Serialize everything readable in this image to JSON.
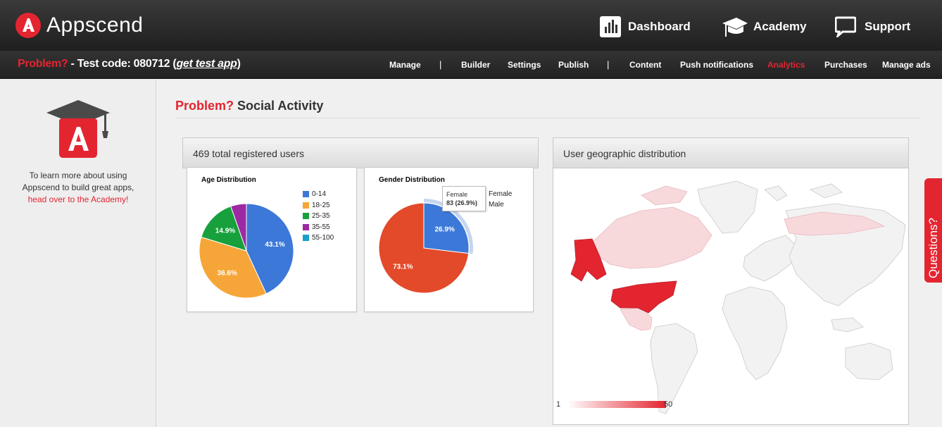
{
  "header": {
    "brand": "Appscend",
    "nav": [
      {
        "label": "Dashboard",
        "icon": "bar-chart-icon"
      },
      {
        "label": "Academy",
        "icon": "graduation-cap-icon"
      },
      {
        "label": "Support",
        "icon": "speech-bubble-icon"
      }
    ]
  },
  "subheader": {
    "app_name": "Problem?",
    "test_code_text": " - Test code: 080712 (",
    "get_test_app": "get test app",
    "close_paren": ")",
    "nav": [
      "Manage",
      "Builder",
      "Settings",
      "Publish",
      "Content",
      "Push notifications",
      "Analytics",
      "Purchases",
      "Manage ads"
    ],
    "separator": "|",
    "active": "Analytics"
  },
  "sidebar": {
    "text_line1": "To learn more about using",
    "text_line2": "Appscend to build great apps,",
    "link_text": "head over to the Academy!"
  },
  "page": {
    "title_red": "Problem?",
    "title_rest": " Social Activity"
  },
  "users_panel": {
    "header": "469 total registered users"
  },
  "geo_panel": {
    "header": "User geographic distribution",
    "scale_min": "1",
    "scale_max": "50"
  },
  "questions_tab": "Questions?",
  "colors": {
    "accent": "#e32530",
    "blue": "#3c78d8",
    "orange": "#f6a638",
    "green": "#17a03c",
    "purple": "#9d2aa3",
    "teal": "#1aa0c8",
    "male_red": "#e34a2a"
  },
  "chart_data": [
    {
      "type": "pie",
      "title": "Age Distribution",
      "categories": [
        "0-14",
        "18-25",
        "25-35",
        "35-55",
        "55-100"
      ],
      "values": [
        43.1,
        36.6,
        14.9,
        5.4,
        0
      ],
      "labels": [
        "43.1%",
        "36.6%",
        "14.9%",
        "",
        ""
      ],
      "colors": [
        "#3c78d8",
        "#f6a638",
        "#17a03c",
        "#9d2aa3",
        "#1aa0c8"
      ],
      "legend": "right"
    },
    {
      "type": "pie",
      "title": "Gender Distribution",
      "categories": [
        "Female",
        "Male"
      ],
      "values": [
        26.9,
        73.1
      ],
      "labels": [
        "26.9%",
        "73.1%"
      ],
      "colors": [
        "#3c78d8",
        "#e34a2a"
      ],
      "legend": "right",
      "tooltip": {
        "name": "Female",
        "value": "83 (26.9%)"
      }
    }
  ]
}
